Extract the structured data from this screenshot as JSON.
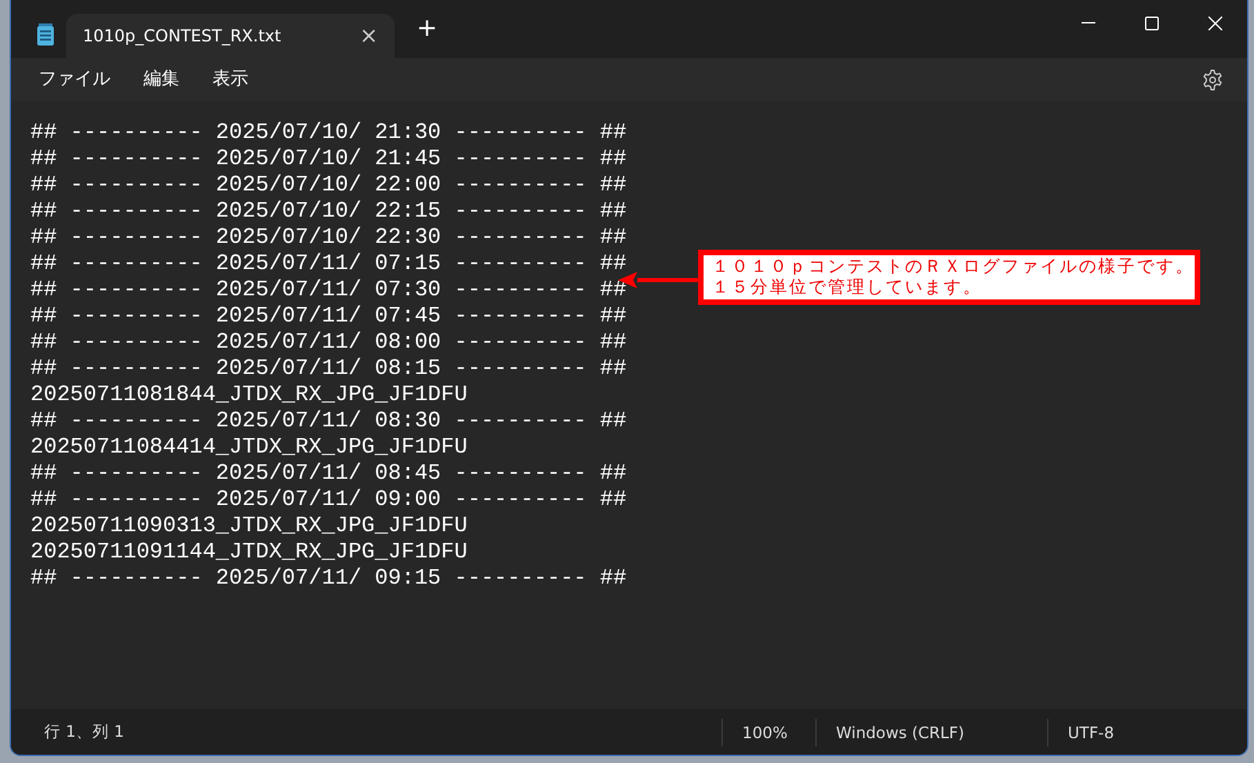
{
  "window": {
    "tab_title": "1010p_CONTEST_RX.txt",
    "tab_close": "×",
    "new_tab": "+"
  },
  "menu": [
    "ファイル",
    "編集",
    "表示"
  ],
  "lines": [
    "## ---------- 2025/07/10/ 21:30 ---------- ##",
    "## ---------- 2025/07/10/ 21:45 ---------- ##",
    "## ---------- 2025/07/10/ 22:00 ---------- ##",
    "## ---------- 2025/07/10/ 22:15 ---------- ##",
    "## ---------- 2025/07/10/ 22:30 ---------- ##",
    "## ---------- 2025/07/11/ 07:15 ---------- ##",
    "## ---------- 2025/07/11/ 07:30 ---------- ##",
    "## ---------- 2025/07/11/ 07:45 ---------- ##",
    "## ---------- 2025/07/11/ 08:00 ---------- ##",
    "## ---------- 2025/07/11/ 08:15 ---------- ##",
    "20250711081844_JTDX_RX_JPG_JF1DFU",
    "## ---------- 2025/07/11/ 08:30 ---------- ##",
    "20250711084414_JTDX_RX_JPG_JF1DFU",
    "## ---------- 2025/07/11/ 08:45 ---------- ##",
    "## ---------- 2025/07/11/ 09:00 ---------- ##",
    "20250711090313_JTDX_RX_JPG_JF1DFU",
    "20250711091144_JTDX_RX_JPG_JF1DFU",
    "## ---------- 2025/07/11/ 09:15 ---------- ##"
  ],
  "annotation": {
    "lines": [
      "１０１０ｐコンテストのＲＸログファイルの様子です。",
      "１５分単位で管理しています。"
    ]
  },
  "status_bar": {
    "position": "行 1、列 1",
    "zoom": "100%",
    "line_ending": "Windows (CRLF)",
    "encoding": "UTF-8"
  }
}
